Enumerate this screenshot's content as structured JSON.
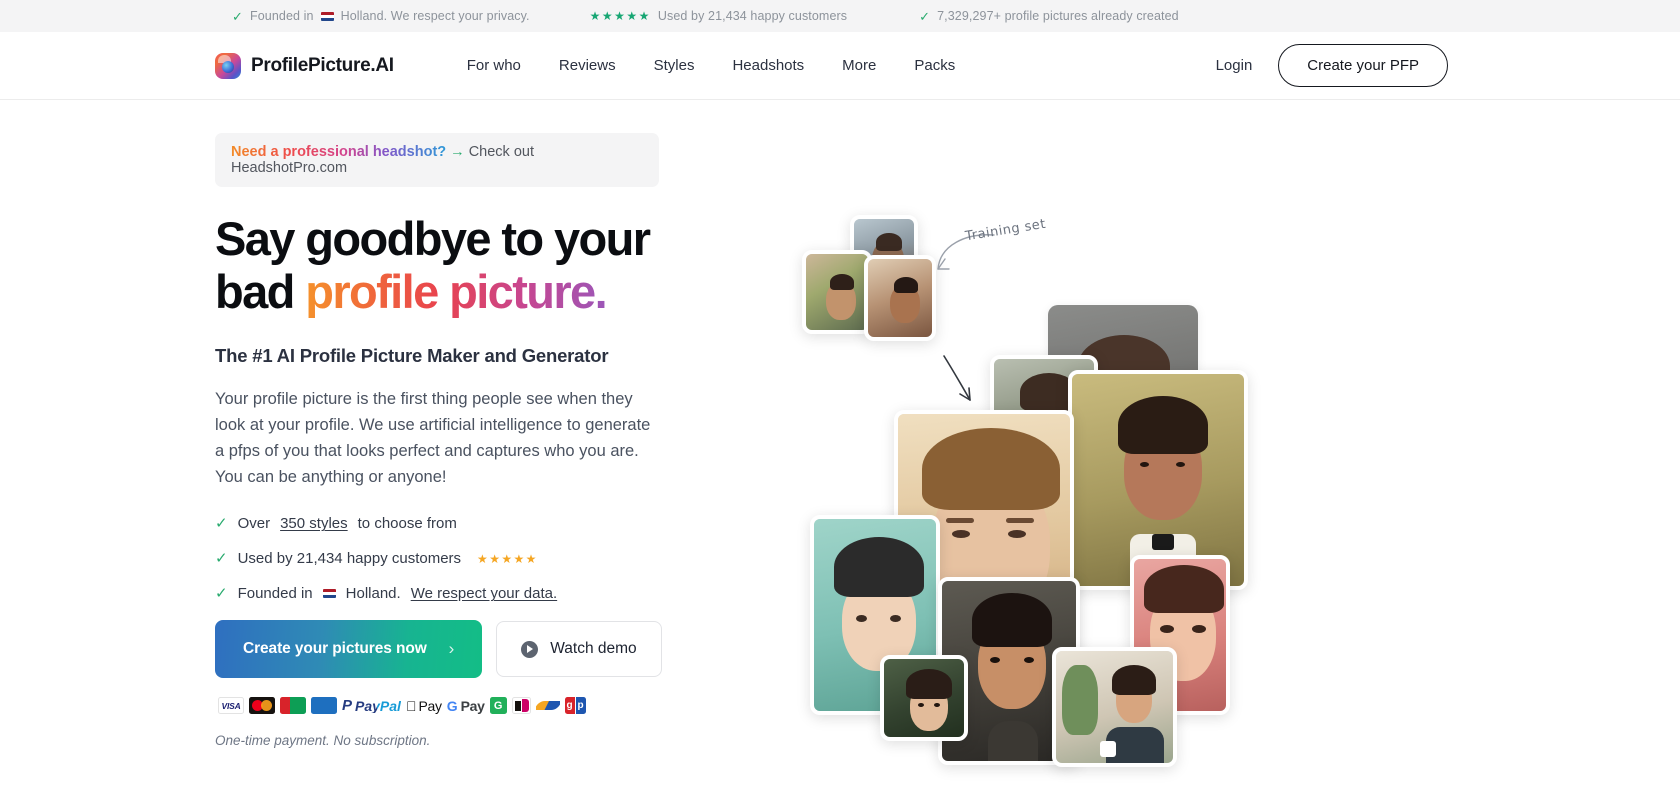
{
  "topbar": {
    "items": [
      {
        "icon": "check-icon",
        "text_before_flag": "Founded in",
        "flag": "netherlands-flag",
        "text_after_flag": "Holland. We respect your privacy."
      },
      {
        "icon": "stars-icon",
        "stars": "★★★★★",
        "text": "Used by 21,434 happy customers"
      },
      {
        "icon": "check-icon",
        "text": "7,329,297+ profile pictures already created"
      }
    ]
  },
  "header": {
    "brand": "ProfilePicture.AI",
    "logo_icon": "profilepicture-logo-icon",
    "nav": [
      {
        "label": "For who"
      },
      {
        "label": "Reviews"
      },
      {
        "label": "Styles"
      },
      {
        "label": "Headshots"
      },
      {
        "label": "More"
      },
      {
        "label": "Packs"
      }
    ],
    "login_label": "Login",
    "cta_label": "Create your PFP"
  },
  "promo": {
    "strong": "Need a professional headshot?",
    "arrow": "→",
    "rest": "Check out HeadshotPro.com"
  },
  "hero": {
    "headline_line1": "Say goodbye to your",
    "headline_line2_plain": "bad ",
    "headline_line2_gradient": "profile picture.",
    "subheadline": "The #1 AI Profile Picture Maker and Generator",
    "body": "Your profile picture is the first thing people see when they look at your profile. We use artificial intelligence to generate a pfps of you that looks perfect and captures who you are. You can be anything or anyone!",
    "features": [
      {
        "icon": "check-icon",
        "pre": "Over ",
        "link": "350 styles ",
        "post": "to choose from"
      },
      {
        "icon": "check-icon",
        "pre": "Used by 21,434 happy customers",
        "stars": "★★★★★"
      },
      {
        "icon": "check-icon",
        "pre": "Founded in ",
        "flag": "netherlands-flag",
        "mid": " Holland. ",
        "link": "We respect your data."
      }
    ],
    "primary_cta": "Create your pictures now",
    "primary_cta_chevron": "›",
    "secondary_cta": "Watch demo",
    "secondary_cta_icon": "play-circle-icon",
    "note": "One-time payment. No subscription."
  },
  "payments": [
    {
      "name": "visa-icon",
      "label": "VISA"
    },
    {
      "name": "mastercard-icon",
      "label": ""
    },
    {
      "name": "maestro-icon",
      "label": "Maestro"
    },
    {
      "name": "amex-icon",
      "label": "AMEX"
    },
    {
      "name": "paypal-icon",
      "glyph": "P",
      "label": "PayPal"
    },
    {
      "name": "apple-pay-icon",
      "glyph": "",
      "label": "Pay"
    },
    {
      "name": "google-pay-icon",
      "glyph": "G",
      "label": "Pay"
    },
    {
      "name": "giropay-icon",
      "label": "G"
    },
    {
      "name": "ideal-icon",
      "label": ""
    },
    {
      "name": "sofort-icon",
      "label": ""
    },
    {
      "name": "gpay-badge-icon",
      "label_g": "g",
      "label_p": "p"
    }
  ],
  "collage": {
    "annotation": "Training set",
    "arrow_icon": "curved-arrow-icon",
    "training_photos": [
      {
        "name": "training-photo-1"
      },
      {
        "name": "training-photo-2"
      },
      {
        "name": "training-photo-3"
      }
    ],
    "generated_photos": [
      {
        "name": "generated-photo-1"
      },
      {
        "name": "generated-photo-2"
      },
      {
        "name": "generated-photo-3"
      },
      {
        "name": "generated-photo-4"
      },
      {
        "name": "generated-photo-5"
      },
      {
        "name": "generated-photo-6"
      },
      {
        "name": "generated-photo-7"
      },
      {
        "name": "generated-photo-8"
      },
      {
        "name": "generated-photo-9"
      }
    ]
  },
  "colors": {
    "accent_green": "#2aab6f",
    "star_gold": "#f5a623",
    "cta_gradient_start": "#2f6fc0",
    "cta_gradient_end": "#13bd86",
    "text_dark": "#15181f",
    "text_body": "#4a5260",
    "topbar_bg": "#f4f4f5"
  }
}
